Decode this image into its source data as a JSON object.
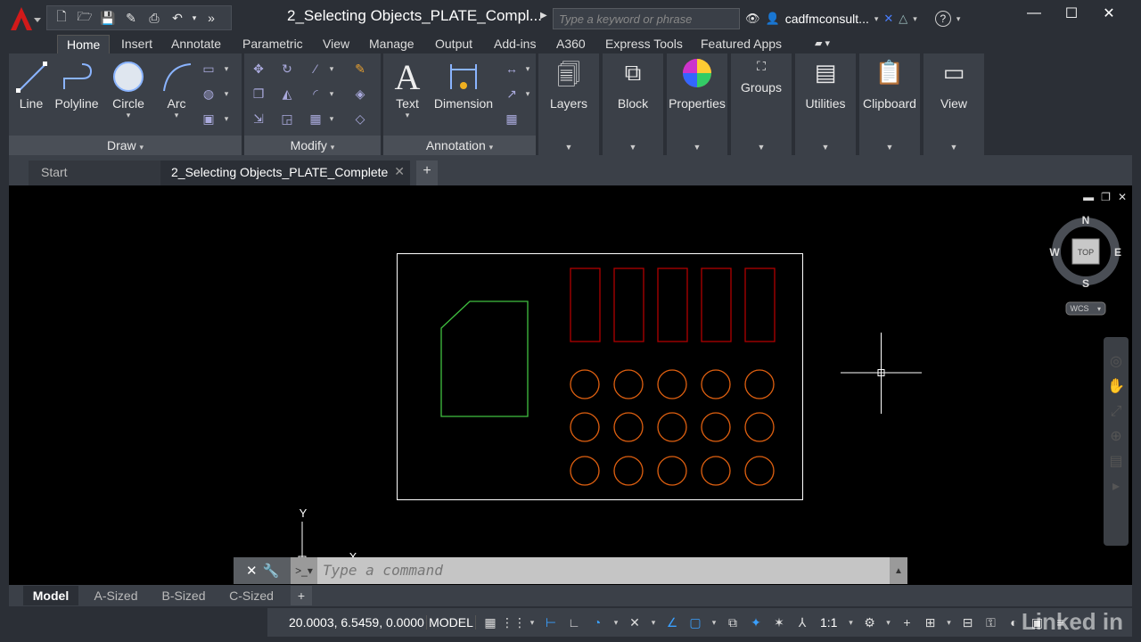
{
  "titlebar": {
    "doc_title": "2_Selecting Objects_PLATE_Compl...",
    "search_placeholder": "Type a keyword or phrase",
    "user_name": "cadfmconsult..."
  },
  "ribbon_tabs": [
    "Home",
    "Insert",
    "Annotate",
    "Parametric",
    "View",
    "Manage",
    "Output",
    "Add-ins",
    "A360",
    "Express Tools",
    "Featured Apps"
  ],
  "ribbon": {
    "draw": {
      "title": "Draw",
      "tools": [
        "Line",
        "Polyline",
        "Circle",
        "Arc"
      ]
    },
    "modify": {
      "title": "Modify"
    },
    "annotation": {
      "title": "Annotation",
      "tools": [
        "Text",
        "Dimension"
      ]
    },
    "large": [
      "Layers",
      "Block",
      "Properties",
      "Groups",
      "Utilities",
      "Clipboard",
      "View"
    ]
  },
  "doc_tabs": {
    "start": "Start",
    "active": "2_Selecting Objects_PLATE_Complete"
  },
  "viewcube": {
    "n": "N",
    "s": "S",
    "e": "E",
    "w": "W",
    "top": "TOP",
    "wcs": "WCS"
  },
  "ucs": {
    "y": "Y",
    "x": "X"
  },
  "command": {
    "placeholder": "Type a command"
  },
  "layout_tabs": [
    "Model",
    "A-Sized",
    "B-Sized",
    "C-Sized"
  ],
  "status": {
    "coords": "20.0003, 6.5459, 0.0000",
    "mode": "MODEL",
    "scale": "1:1",
    "watermark": "Linked in"
  },
  "colors": {
    "background": "#000000",
    "plate": "#ffffff",
    "slots": "#b00000",
    "holes": "#e06010",
    "polygon": "#40c040"
  }
}
